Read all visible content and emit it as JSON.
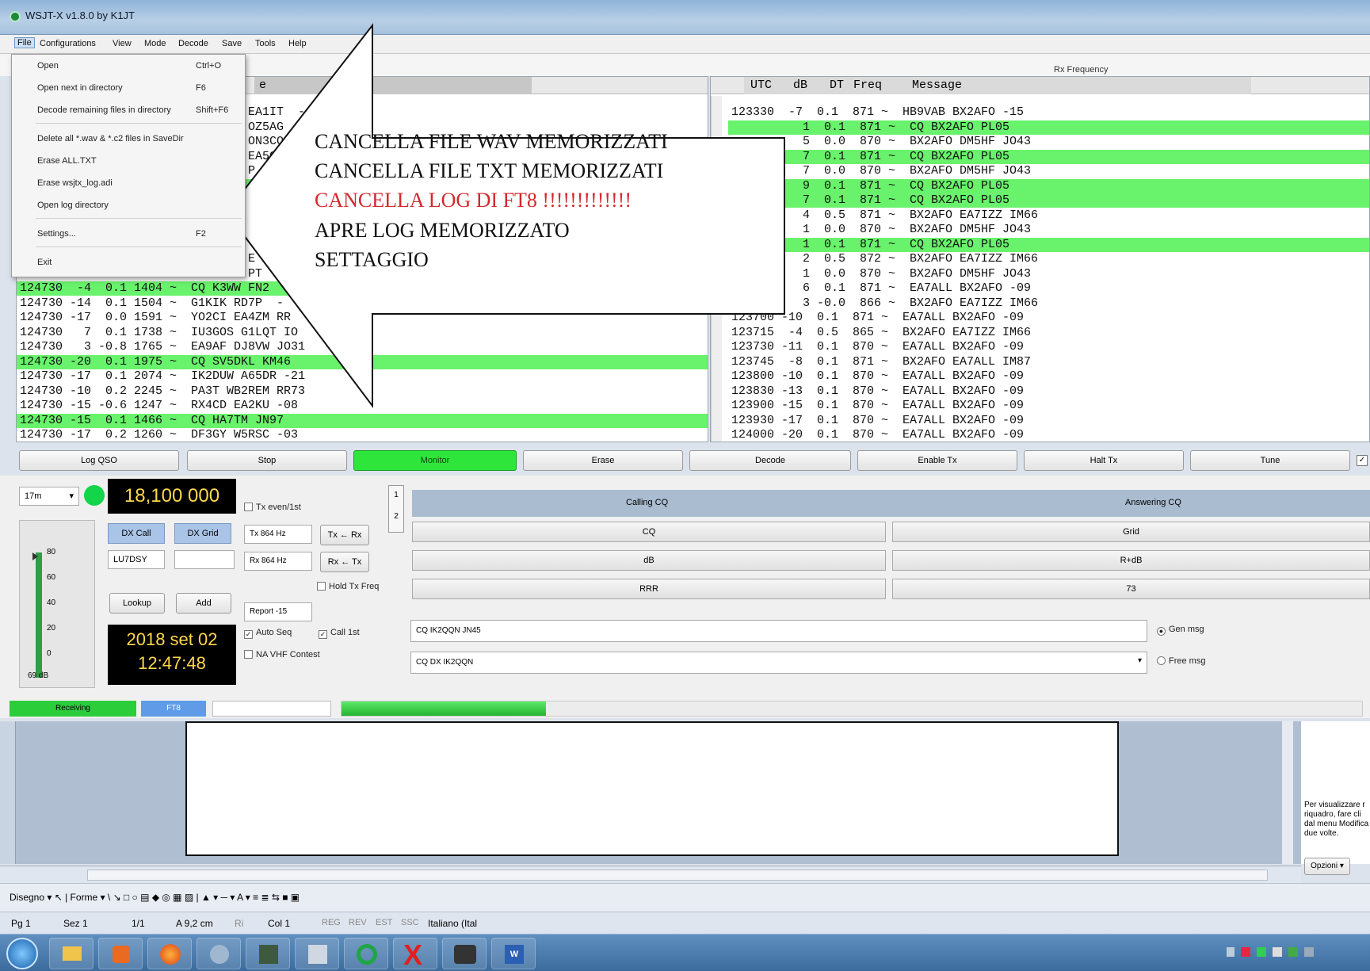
{
  "window": {
    "title": "WSJT-X  v1.8.0  by K1JT"
  },
  "menubar": {
    "items": [
      "File",
      "Configurations",
      "View",
      "Mode",
      "Decode",
      "Save",
      "Tools",
      "Help"
    ]
  },
  "rx_pane": {
    "label": "Rx Frequency"
  },
  "left_pane": {
    "header_message": "e",
    "lines": [
      {
        "t": "                                EA1IT  -",
        "hl": false
      },
      {
        "t": "                                OZ5AG",
        "hl": false
      },
      {
        "t": "                                ON3CO",
        "hl": false
      },
      {
        "t": "                                EA5C",
        "hl": false
      },
      {
        "t": "                                P",
        "hl": false
      },
      {
        "t": "",
        "hl": true
      },
      {
        "t": "",
        "hl": false
      },
      {
        "t": "",
        "hl": false
      },
      {
        "t": "",
        "hl": false
      },
      {
        "t": "",
        "hl": false
      },
      {
        "t": "                                E",
        "hl": false
      },
      {
        "t": "                                PT",
        "hl": false
      },
      {
        "t": "124730  -4  0.1 1404 ~  CQ K3WW FN2",
        "hl": true
      },
      {
        "t": "124730 -14  0.1 1504 ~  G1KIK RD7P  -",
        "hl": false
      },
      {
        "t": "124730 -17  0.0 1591 ~  YO2CI EA4ZM RR",
        "hl": false
      },
      {
        "t": "124730   7  0.1 1738 ~  IU3GOS G1LQT IO",
        "hl": false
      },
      {
        "t": "124730   3 -0.8 1765 ~  EA9AF DJ8VW JO31",
        "hl": false
      },
      {
        "t": "124730 -20  0.1 1975 ~  CQ SV5DKL KM46",
        "hl": true
      },
      {
        "t": "124730 -17  0.1 2074 ~  IK2DUW A65DR -21",
        "hl": false
      },
      {
        "t": "124730 -10  0.2 2245 ~  PA3T WB2REM RR73",
        "hl": false
      },
      {
        "t": "124730 -15 -0.6 1247 ~  RX4CD EA2KU -08",
        "hl": false
      },
      {
        "t": "124730 -15  0.1 1466 ~  CQ HA7TM JN97",
        "hl": true
      },
      {
        "t": "124730 -17  0.2 1260 ~  DF3GY W5RSC -03",
        "hl": false
      }
    ]
  },
  "right_pane": {
    "header": {
      "utc": "UTC",
      "db": "dB",
      "dt": "DT",
      "freq": "Freq",
      "message": "Message"
    },
    "lines": [
      {
        "t": "123330  -7  0.1  871 ~  HB9VAB BX2AFO -15",
        "hl": false
      },
      {
        "t": "          1  0.1  871 ~  CQ BX2AFO PL05",
        "hl": true
      },
      {
        "t": "          5  0.0  870 ~  BX2AFO DM5HF JO43",
        "hl": false
      },
      {
        "t": "          7  0.1  871 ~  CQ BX2AFO PL05",
        "hl": true
      },
      {
        "t": "          7  0.0  870 ~  BX2AFO DM5HF JO43",
        "hl": false
      },
      {
        "t": "          9  0.1  871 ~  CQ BX2AFO PL05",
        "hl": true
      },
      {
        "t": "          7  0.1  871 ~  CQ BX2AFO PL05",
        "hl": true
      },
      {
        "t": "          4  0.5  871 ~  BX2AFO EA7IZZ IM66",
        "hl": false
      },
      {
        "t": "          1  0.0  870 ~  BX2AFO DM5HF JO43",
        "hl": false
      },
      {
        "t": "          1  0.1  871 ~  CQ BX2AFO PL05",
        "hl": true
      },
      {
        "t": "          2  0.5  872 ~  BX2AFO EA7IZZ IM66",
        "hl": false
      },
      {
        "t": "          1  0.0  870 ~  BX2AFO DM5HF JO43",
        "hl": false
      },
      {
        "t": "          6  0.1  871 ~  EA7ALL BX2AFO -09",
        "hl": false
      },
      {
        "t": "          3 -0.0  866 ~  BX2AFO EA7IZZ IM66",
        "hl": false
      },
      {
        "t": "123700 -10  0.1  871 ~  EA7ALL BX2AFO -09",
        "hl": false
      },
      {
        "t": "123715  -4  0.5  865 ~  BX2AFO EA7IZZ IM66",
        "hl": false
      },
      {
        "t": "123730 -11  0.1  870 ~  EA7ALL BX2AFO -09",
        "hl": false
      },
      {
        "t": "123745  -8  0.1  871 ~  BX2AFO EA7ALL IM87",
        "hl": false
      },
      {
        "t": "123800 -10  0.1  870 ~  EA7ALL BX2AFO -09",
        "hl": false
      },
      {
        "t": "123830 -13  0.1  870 ~  EA7ALL BX2AFO -09",
        "hl": false
      },
      {
        "t": "123900 -15  0.1  870 ~  EA7ALL BX2AFO -09",
        "hl": false
      },
      {
        "t": "123930 -17  0.1  870 ~  EA7ALL BX2AFO -09",
        "hl": false
      },
      {
        "t": "124000 -20  0.1  870 ~  EA7ALL BX2AFO -09",
        "hl": false
      }
    ]
  },
  "buttons": {
    "log_qso": "Log QSO",
    "stop": "Stop",
    "monitor": "Monitor",
    "erase": "Erase",
    "decode": "Decode",
    "enable_tx": "Enable Tx",
    "halt_tx": "Halt Tx",
    "tune": "Tune"
  },
  "controls": {
    "band": "17m",
    "frequency": "18,100 000",
    "dx_call_label": "DX Call",
    "dx_grid_label": "DX Grid",
    "dx_call_value": "LU7DSY",
    "dx_grid_value": "",
    "tx_hz": "Tx 864 Hz",
    "rx_hz": "Rx 864 Hz",
    "tx_eq_rx": "Tx ← Rx",
    "rx_eq_tx": "Rx ← Tx",
    "tx_even": "Tx even/1st",
    "hold_tx_freq": "Hold Tx Freq",
    "lookup": "Lookup",
    "add": "Add",
    "report": "Report -15",
    "auto_seq": "Auto Seq",
    "call_1st": "Call 1st",
    "na_vhf": "NA VHF Contest",
    "date": "2018 set 02",
    "time": "12:47:48",
    "meter_ticks": [
      "80",
      "60",
      "40",
      "20",
      "0"
    ],
    "meter_db": "69 dB"
  },
  "messages": {
    "tab1": "1",
    "tab2": "2",
    "calling_cq": "Calling CQ",
    "answering_cq": "Answering CQ",
    "cq": "CQ",
    "grid": "Grid",
    "db": "dB",
    "rdb": "R+dB",
    "rrr": "RRR",
    "n73": "73",
    "gen_input": "CQ IK2QQN JN45",
    "gen_msg": "Gen msg",
    "free_input": "CQ DX IK2QQN",
    "free_msg": "Free msg"
  },
  "status": {
    "receiving": "Receiving",
    "mode": "FT8"
  },
  "file_menu": {
    "items": [
      {
        "label": "Open",
        "shortcut": "Ctrl+O"
      },
      {
        "label": "Open next in directory",
        "shortcut": "F6"
      },
      {
        "label": "Decode remaining files in directory",
        "shortcut": "Shift+F6"
      },
      {
        "label": "Delete all *.wav & *.c2 files in SaveDir",
        "shortcut": ""
      },
      {
        "label": "Erase ALL.TXT",
        "shortcut": ""
      },
      {
        "label": "Erase wsjtx_log.adi",
        "shortcut": ""
      },
      {
        "label": "Open log directory",
        "shortcut": ""
      },
      {
        "label": "Settings...",
        "shortcut": "F2"
      },
      {
        "label": "Exit",
        "shortcut": ""
      }
    ]
  },
  "annotation": {
    "lines": [
      {
        "text": "CANCELLA FILE WAV MEMORIZZATI",
        "color": "#111111"
      },
      {
        "text": "CANCELLA FILE TXT MEMORIZZATI",
        "color": "#111111"
      },
      {
        "text": "CANCELLA LOG DI FT8 !!!!!!!!!!!!!",
        "color": "#d4282d"
      },
      {
        "text": "APRE LOG MEMORIZZATO",
        "color": "#111111"
      },
      {
        "text": "SETTAGGIO",
        "color": "#111111"
      }
    ]
  },
  "word": {
    "hint_lines": [
      "Per visualizzare r",
      "riquadro, fare cli",
      "dal menu Modifica",
      "due volte."
    ],
    "options_btn": "Opzioni ▾",
    "draw_toolbar": "Disegno ▾  ↖ | Forme ▾  \\  ↘  □  ○  ▤  ◆  ◎  ▦  ▨  | ▲ ▾  ─ ▾  A ▾  ≡  ≣  ⇆  ■  ▣",
    "status": {
      "page": "Pg 1",
      "section": "Sez 1",
      "pages": "1/1",
      "at": "A 9,2 cm",
      "ri": "Ri",
      "col": "Col 1",
      "reg": "REG",
      "rev": "REV",
      "est": "EST",
      "ssc": "SSC",
      "lang": "Italiano (Ital"
    }
  }
}
